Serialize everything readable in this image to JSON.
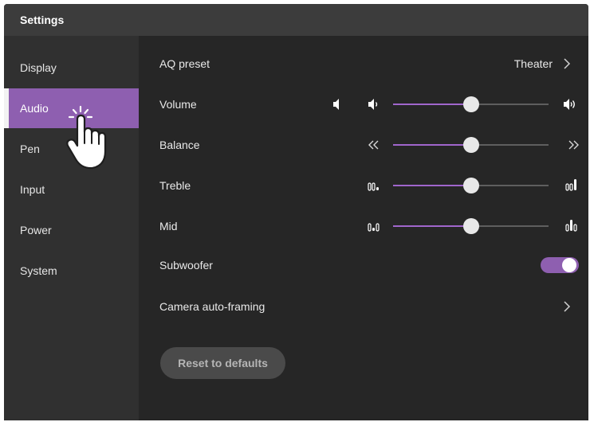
{
  "window": {
    "title": "Settings"
  },
  "sidebar": {
    "items": [
      {
        "label": "Display"
      },
      {
        "label": "Audio"
      },
      {
        "label": "Pen"
      },
      {
        "label": "Input"
      },
      {
        "label": "Power"
      },
      {
        "label": "System"
      }
    ],
    "active_item": "Audio"
  },
  "settings": {
    "aq_preset": {
      "label": "AQ preset",
      "value": "Theater",
      "icon": "chevron-right-icon"
    },
    "volume": {
      "label": "Volume",
      "value": 50,
      "mute_icon": "speaker-muted-icon",
      "low_icon": "speaker-low-icon",
      "high_icon": "speaker-high-icon"
    },
    "balance": {
      "label": "Balance",
      "value": 50,
      "left_icon": "double-chevron-left-icon",
      "right_icon": "double-chevron-right-icon"
    },
    "treble": {
      "label": "Treble",
      "value": 50,
      "low_icon": "treble-low-icon",
      "high_icon": "treble-high-icon"
    },
    "mid": {
      "label": "Mid",
      "value": 50,
      "low_icon": "mid-low-icon",
      "high_icon": "mid-high-icon"
    },
    "subwoofer": {
      "label": "Subwoofer",
      "on": true
    },
    "camera_auto_framing": {
      "label": "Camera auto-framing",
      "icon": "chevron-right-icon"
    }
  },
  "actions": {
    "reset_label": "Reset to defaults"
  },
  "colors": {
    "accent": "#8e5fb0",
    "background": "#262626",
    "sidebar": "#303030",
    "titlebar": "#3c3c3c"
  }
}
